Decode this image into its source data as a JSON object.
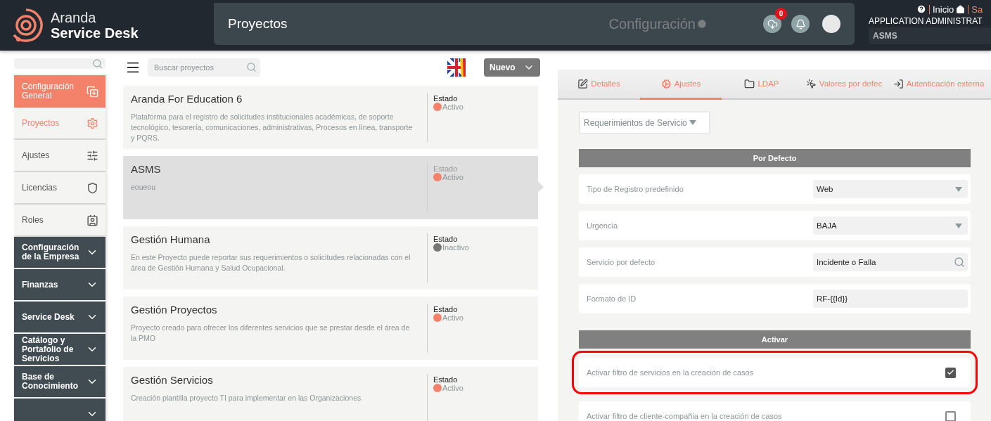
{
  "header": {
    "brand_top": "Aranda",
    "brand_bottom": "Service Desk",
    "page_title": "Proyectos",
    "section": "Configuración",
    "downloads_badge": "0",
    "links": [
      {
        "label": "Inicio",
        "kind": "home"
      },
      {
        "label": "Sa",
        "kind": "logout"
      }
    ],
    "user": "APPLICATION ADMINISTRAT",
    "project": "ASMS"
  },
  "sidebar": {
    "items": [
      {
        "label": "Configuración General",
        "kind": "header"
      },
      {
        "label": "Proyectos",
        "kind": "item",
        "selected": true
      },
      {
        "label": "Ajustes",
        "kind": "item",
        "selected": false
      },
      {
        "label": "Licencias",
        "kind": "item",
        "selected": false
      },
      {
        "label": "Roles",
        "kind": "item",
        "selected": false
      },
      {
        "label": "Configuración de la Empresa",
        "kind": "group",
        "expanded": false
      },
      {
        "label": "Finanzas",
        "kind": "group",
        "expanded": false
      },
      {
        "label": "Service Desk",
        "kind": "group",
        "expanded": false
      },
      {
        "label": "Catálogo y Portafolio de Servicios",
        "kind": "group",
        "expanded": false
      },
      {
        "label": "Base de Conocimiento",
        "kind": "group",
        "expanded": false
      },
      {
        "kind": "group",
        "expanded": false
      }
    ]
  },
  "projects": {
    "search": {
      "placeholder": "Buscar proyectos"
    },
    "new_button": "Nuevo",
    "items": [
      {
        "name": "Aranda For Education 6",
        "description": "Plataforma para el registro de solicitudes institucionales académicas, de soporte tecnológico, tesorería, comunicaciones, administrativas, Procesos en línea, transporte y PQRS.",
        "status_label": "Estado",
        "status": "Activo",
        "active": true,
        "selected": false
      },
      {
        "name": "ASMS",
        "description": "eoueou",
        "status_label": "Estado",
        "status": "Activo",
        "active": true,
        "selected": true
      },
      {
        "name": "Gestión Humana",
        "description": "En este Proyecto puede reportar sus requerimientos o solicitudes relacionadas con el área de Gestión Humana y Salud Ocupacional.",
        "status_label": "Estado",
        "status": "Inactivo",
        "active": false,
        "selected": false
      },
      {
        "name": "Gestión Proyectos",
        "description": "Proyecto creado para ofrecer los diferentes servicios que se prestar desde el área de la PMO",
        "status_label": "Estado",
        "status": "Activo",
        "active": true,
        "selected": false
      },
      {
        "name": "Gestión Servicios",
        "description": "Creación plantilla proyecto TI para implementar en las Organizaciones",
        "status_label": "Estado",
        "status": "Activo",
        "active": true,
        "selected": false
      }
    ]
  },
  "panel": {
    "tabs": [
      {
        "label": "Detalles",
        "selected": false
      },
      {
        "label": "Ajustes",
        "selected": true
      },
      {
        "label": "LDAP",
        "selected": false
      },
      {
        "label": "Valores por defec",
        "selected": false
      },
      {
        "label": "Autenticación externa",
        "selected": false
      }
    ],
    "case_type": "Requerimientos de Servicio",
    "sections": [
      {
        "title": "Por Defecto",
        "rows": [
          {
            "kind": "select",
            "label": "Tipo de Registro predefinido",
            "value": "Web"
          },
          {
            "kind": "select",
            "label": "Urgencia",
            "value": "BAJA"
          },
          {
            "kind": "search",
            "label": "Servicio por defecto",
            "value": "Incidente o Falla"
          },
          {
            "kind": "text",
            "label": "Formato de ID",
            "value": "RF-{{Id}}"
          }
        ]
      },
      {
        "title": "Activar",
        "rows": [
          {
            "kind": "checkbox",
            "label": "Activar filtro de servicios en la creación de casos",
            "checked": true,
            "highlighted": true
          },
          {
            "kind": "checkbox",
            "label": "Activar filtro de cliente-compañia en la creación de casos",
            "checked": false,
            "highlighted": false
          }
        ]
      }
    ]
  }
}
